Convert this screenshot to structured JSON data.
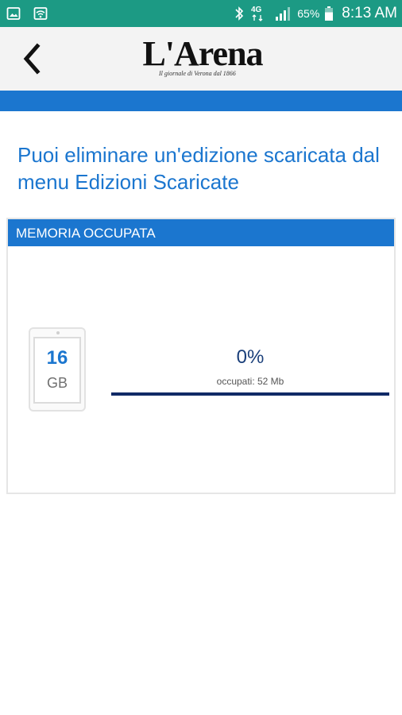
{
  "status_bar": {
    "battery_percent": "65%",
    "time": "8:13 AM",
    "network": "4G",
    "icons": [
      "image-icon",
      "wifi-icon",
      "bluetooth-icon",
      "network-4g-icon",
      "signal-icon",
      "battery-icon"
    ],
    "color": "#1c9a84"
  },
  "header": {
    "logo_title": "L'Arena",
    "logo_subtitle": "Il giornale di Verona dal 1866",
    "back_icon": "back-arrow-icon"
  },
  "message": {
    "text": "Puoi eliminare un'edizione scaricata dal menu Edizioni Scaricate"
  },
  "memory": {
    "header": "MEMORIA OCCUPATA",
    "device_size": "16",
    "device_unit": "GB",
    "percent_label": "0%",
    "occupied_label": "occupati: 52 Mb",
    "progress_fraction": 0.0
  },
  "colors": {
    "accent": "#1b76cf",
    "progress_track": "#102a66"
  }
}
